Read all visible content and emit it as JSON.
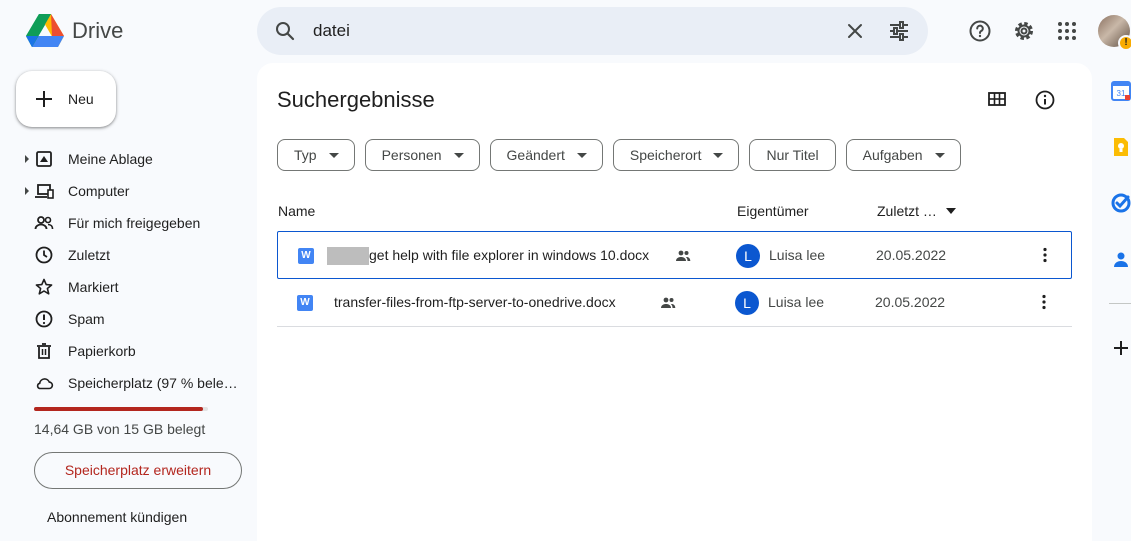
{
  "header": {
    "app_name": "Drive",
    "search": {
      "value": "datei"
    },
    "icons": {
      "help": "help-icon",
      "settings": "gear-icon",
      "apps": "apps-grid-icon"
    }
  },
  "sidebar": {
    "new_label": "Neu",
    "items": [
      {
        "label": "Meine Ablage",
        "icon": "my-drive-icon",
        "expandable": true
      },
      {
        "label": "Computer",
        "icon": "computer-icon",
        "expandable": true
      },
      {
        "label": "Für mich freigegeben",
        "icon": "shared-people-icon",
        "expandable": false
      },
      {
        "label": "Zuletzt",
        "icon": "clock-icon",
        "expandable": false
      },
      {
        "label": "Markiert",
        "icon": "star-icon",
        "expandable": false
      },
      {
        "label": "Spam",
        "icon": "spam-icon",
        "expandable": false
      },
      {
        "label": "Papierkorb",
        "icon": "trash-icon",
        "expandable": false
      },
      {
        "label": "Speicherplatz (97 % bele…",
        "icon": "cloud-icon",
        "expandable": false
      }
    ],
    "storage": {
      "used_fraction": 0.97,
      "text": "14,64 GB von 15 GB belegt",
      "bar_color": "#b3261e"
    },
    "upgrade_label": "Speicherplatz erweitern",
    "cancel_label": "Abonnement kündigen"
  },
  "main": {
    "title": "Suchergebnisse",
    "filters": [
      {
        "label": "Typ",
        "dropdown": true
      },
      {
        "label": "Personen",
        "dropdown": true
      },
      {
        "label": "Geändert",
        "dropdown": true
      },
      {
        "label": "Speicherort",
        "dropdown": true
      },
      {
        "label": "Nur Titel",
        "dropdown": false
      },
      {
        "label": "Aufgaben",
        "dropdown": true
      }
    ],
    "columns": {
      "name": "Name",
      "owner": "Eigentümer",
      "modified": "Zuletzt …"
    },
    "rows": [
      {
        "icon_letter": "W",
        "name": "get help with file explorer in windows 10.docx",
        "name_prefix_redacted": true,
        "shared": true,
        "owner_initial": "L",
        "owner": "Luisa lee",
        "modified": "20.05.2022",
        "selected": true
      },
      {
        "icon_letter": "W",
        "name": "transfer-files-from-ftp-server-to-onedrive.docx",
        "name_prefix_redacted": false,
        "shared": true,
        "owner_initial": "L",
        "owner": "Luisa lee",
        "modified": "20.05.2022",
        "selected": false
      }
    ]
  },
  "right_rail": [
    "calendar-icon",
    "keep-icon",
    "tasks-icon",
    "contacts-icon",
    "add-icon"
  ],
  "colors": {
    "accent": "#0b57d0",
    "background": "#f8fafd",
    "search_bg": "#e9eef6"
  }
}
